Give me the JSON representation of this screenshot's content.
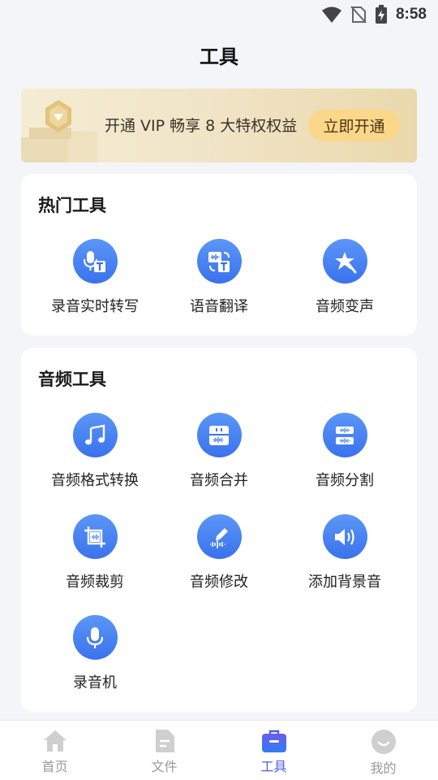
{
  "status_bar": {
    "time": "8:58"
  },
  "header": {
    "title": "工具"
  },
  "vip_banner": {
    "text": "开通 VIP 畅享 8 大特权权益",
    "button_label": "立即开通"
  },
  "hot_tools": {
    "title": "热门工具",
    "items": [
      {
        "label": "录音实时转写",
        "icon": "mic-text-icon"
      },
      {
        "label": "语音翻译",
        "icon": "translate-icon"
      },
      {
        "label": "音频变声",
        "icon": "magic-star-icon"
      }
    ]
  },
  "audio_tools": {
    "title": "音频工具",
    "items": [
      {
        "label": "音频格式转换",
        "icon": "music-note-icon"
      },
      {
        "label": "音频合并",
        "icon": "merge-icon"
      },
      {
        "label": "音频分割",
        "icon": "split-icon"
      },
      {
        "label": "音频裁剪",
        "icon": "crop-icon"
      },
      {
        "label": "音频修改",
        "icon": "edit-wave-icon"
      },
      {
        "label": "添加背景音",
        "icon": "speaker-icon"
      },
      {
        "label": "录音机",
        "icon": "microphone-icon"
      }
    ]
  },
  "bottom_nav": {
    "items": [
      {
        "label": "首页",
        "icon": "home-icon"
      },
      {
        "label": "文件",
        "icon": "file-icon"
      },
      {
        "label": "工具",
        "icon": "toolbox-icon",
        "active": true
      },
      {
        "label": "我的",
        "icon": "profile-icon"
      }
    ]
  },
  "colors": {
    "accent": "#4f5be8",
    "icon_blue": "#3a72ec",
    "vip_button": "#fbd78a"
  }
}
